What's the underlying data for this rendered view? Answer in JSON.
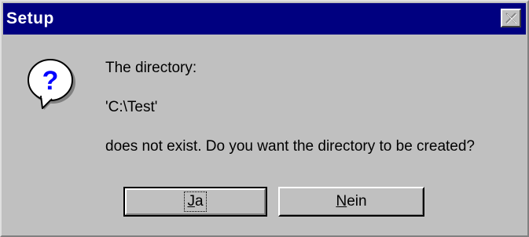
{
  "window": {
    "title": "Setup",
    "close_icon": "close-icon"
  },
  "dialog": {
    "icon": "question-icon",
    "line1": "The directory:",
    "line2": "'C:\\Test'",
    "line3": "does not exist.  Do you want the directory to be created?"
  },
  "buttons": {
    "yes_mnemonic": "J",
    "yes_rest": "a",
    "no_mnemonic": "N",
    "no_rest": "ein"
  },
  "colors": {
    "titlebar": "#000080",
    "face": "#c0c0c0"
  }
}
